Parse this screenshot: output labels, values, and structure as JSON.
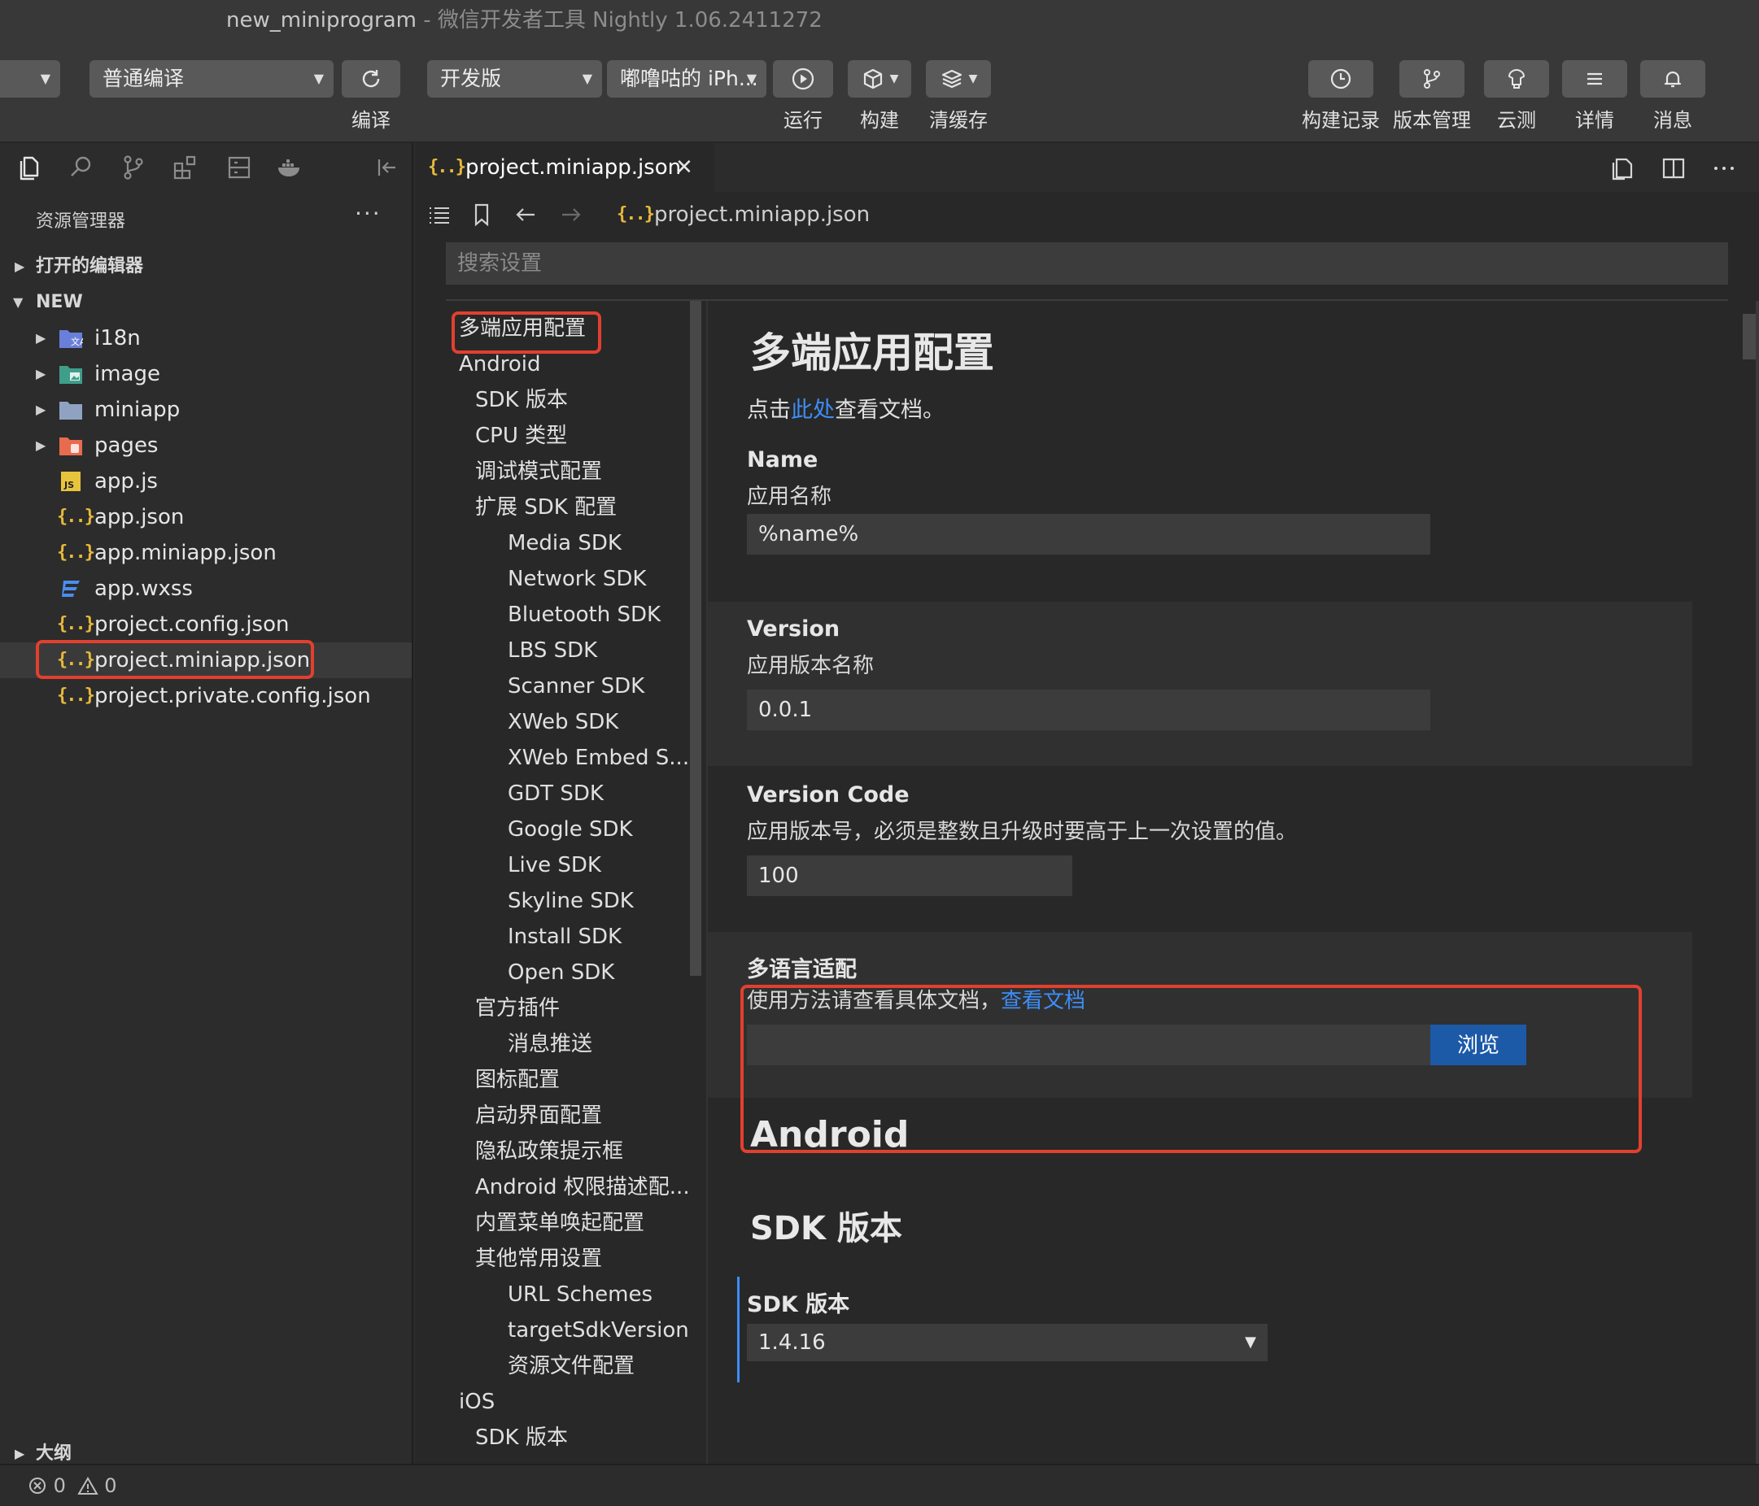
{
  "window": {
    "project_name": "new_miniprogram",
    "separator": " - ",
    "app_name": "微信开发者工具 Nightly 1.06.2411272"
  },
  "toolbar": {
    "compile_mode": "普通编译",
    "compile_label": "编译",
    "version_type": "开发版",
    "device": "嘟噜咕的 iPh...",
    "run_label": "运行",
    "build_label": "构建",
    "clear_cache_label": "清缓存",
    "build_log_label": "构建记录",
    "version_mgmt_label": "版本管理",
    "cloud_test_label": "云测",
    "details_label": "详情",
    "messages_label": "消息"
  },
  "sidebar": {
    "header": "资源管理器",
    "more": "···",
    "open_editors": "打开的编辑器",
    "project_root": "NEW",
    "items": [
      {
        "label": "i18n",
        "icon": "folder-i18n-icon"
      },
      {
        "label": "image",
        "icon": "folder-image-icon"
      },
      {
        "label": "miniapp",
        "icon": "folder-icon"
      },
      {
        "label": "pages",
        "icon": "folder-pages-icon"
      },
      {
        "label": "app.js",
        "icon": "js-file-icon"
      },
      {
        "label": "app.json",
        "icon": "json-file-icon"
      },
      {
        "label": "app.miniapp.json",
        "icon": "json-file-icon"
      },
      {
        "label": "app.wxss",
        "icon": "css-file-icon"
      },
      {
        "label": "project.config.json",
        "icon": "json-file-icon"
      },
      {
        "label": "project.miniapp.json",
        "icon": "json-file-icon"
      },
      {
        "label": "project.private.config.json",
        "icon": "json-file-icon"
      }
    ],
    "outline": "大纲"
  },
  "status": {
    "errors": "0",
    "warnings": "0"
  },
  "editor": {
    "tab_label": "project.miniapp.json",
    "json_icon_text": "{..}",
    "breadcrumb_file": "project.miniapp.json",
    "search_placeholder": "搜索设置"
  },
  "toc": [
    {
      "label": "多端应用配置",
      "level": 0
    },
    {
      "label": "Android",
      "level": 0
    },
    {
      "label": "SDK 版本",
      "level": 1
    },
    {
      "label": "CPU 类型",
      "level": 1
    },
    {
      "label": "调试模式配置",
      "level": 1
    },
    {
      "label": "扩展 SDK 配置",
      "level": 1
    },
    {
      "label": "Media SDK",
      "level": 2
    },
    {
      "label": "Network SDK",
      "level": 2
    },
    {
      "label": "Bluetooth SDK",
      "level": 2
    },
    {
      "label": "LBS SDK",
      "level": 2
    },
    {
      "label": "Scanner SDK",
      "level": 2
    },
    {
      "label": "XWeb SDK",
      "level": 2
    },
    {
      "label": "XWeb Embed S...",
      "level": 2
    },
    {
      "label": "GDT SDK",
      "level": 2
    },
    {
      "label": "Google SDK",
      "level": 2
    },
    {
      "label": "Live SDK",
      "level": 2
    },
    {
      "label": "Skyline SDK",
      "level": 2
    },
    {
      "label": "Install SDK",
      "level": 2
    },
    {
      "label": "Open SDK",
      "level": 2
    },
    {
      "label": "官方插件",
      "level": 1
    },
    {
      "label": "消息推送",
      "level": 2
    },
    {
      "label": "图标配置",
      "level": 1
    },
    {
      "label": "启动界面配置",
      "level": 1
    },
    {
      "label": "隐私政策提示框",
      "level": 1
    },
    {
      "label": "Android 权限描述配...",
      "level": 1
    },
    {
      "label": "内置菜单唤起配置",
      "level": 1
    },
    {
      "label": "其他常用设置",
      "level": 1
    },
    {
      "label": "URL Schemes",
      "level": 2
    },
    {
      "label": "targetSdkVersion",
      "level": 2
    },
    {
      "label": "资源文件配置",
      "level": 2
    },
    {
      "label": "iOS",
      "level": 0
    },
    {
      "label": "SDK 版本",
      "level": 1
    }
  ],
  "settings": {
    "title": "多端应用配置",
    "doc_prefix": "点击",
    "doc_link": "此处",
    "doc_suffix": "查看文档。",
    "name": {
      "title": "Name",
      "desc": "应用名称",
      "value": "%name%"
    },
    "version": {
      "title": "Version",
      "desc": "应用版本名称",
      "value": "0.0.1"
    },
    "version_code": {
      "title": "Version Code",
      "desc": "应用版本号，必须是整数且升级时要高于上一次设置的值。",
      "value": "100"
    },
    "i18n": {
      "title": "多语言适配",
      "desc": "使用方法请查看具体文档，",
      "link": "查看文档",
      "value": "",
      "browse": "浏览"
    },
    "android_heading": "Android",
    "sdk_heading": "SDK 版本",
    "sdk": {
      "title": "SDK 版本",
      "value": "1.4.16"
    }
  },
  "colors": {
    "accent_link": "#3d8ef7",
    "json_icon": "#e8b93c",
    "annotation": "#e2402f",
    "primary_button": "#1c5aa8"
  }
}
